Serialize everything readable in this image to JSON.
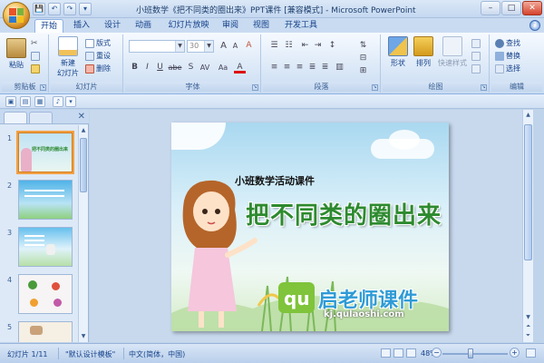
{
  "window": {
    "title": "小班数学《把不同类的圈出来》PPT课件 [兼容模式] - Microsoft PowerPoint",
    "controls": [
      "–",
      "□",
      "✕"
    ]
  },
  "quick_access": [
    "💾",
    "↶",
    "↷",
    "▾"
  ],
  "tabs": [
    {
      "label": "开始",
      "active": true
    },
    {
      "label": "插入"
    },
    {
      "label": "设计"
    },
    {
      "label": "动画"
    },
    {
      "label": "幻灯片放映"
    },
    {
      "label": "审阅"
    },
    {
      "label": "视图"
    },
    {
      "label": "开发工具"
    }
  ],
  "help": "?",
  "ribbon": {
    "clipboard": {
      "label": "剪贴板",
      "paste": "粘贴"
    },
    "slides": {
      "label": "幻灯片",
      "new_slide": "新建",
      "new_slide2": "幻灯片",
      "layout": "版式",
      "reset": "重设",
      "delete": "删除"
    },
    "font": {
      "label": "字体",
      "font_size": "30",
      "bold": "B",
      "italic": "I",
      "underline": "U",
      "strike": "abe",
      "shadow": "S",
      "spacing": "AV",
      "case": "Aa",
      "color": "A",
      "grow": "A",
      "shrink": "A",
      "clear": "A"
    },
    "paragraph": {
      "label": "段落"
    },
    "drawing": {
      "label": "绘图",
      "shapes": "形状",
      "arrange": "排列",
      "quick_styles": "快速样式"
    },
    "editing": {
      "label": "编辑",
      "find": "查找",
      "replace": "替换",
      "select": "选择"
    }
  },
  "slide_panel": {
    "thumbnails": [
      {
        "num": "1",
        "title": "把不同类的圈出来"
      },
      {
        "num": "2"
      },
      {
        "num": "3"
      },
      {
        "num": "4"
      },
      {
        "num": "5"
      }
    ]
  },
  "slide": {
    "subtitle": "小班数学活动课件",
    "title": "把不同类的圈出来",
    "watermark_name": "启老师课件",
    "watermark_url": "kj.qulaoshi.com"
  },
  "status": {
    "slide_pos": "幻灯片 1/11",
    "theme": "\"默认设计模板\"",
    "language": "中文(简体，中国)",
    "zoom": "48%",
    "zoom_minus": "−",
    "zoom_plus": "+"
  },
  "colors": {
    "accent": "#15428b",
    "title_green": "#2d8a2f",
    "selection_orange": "#f2a044"
  }
}
